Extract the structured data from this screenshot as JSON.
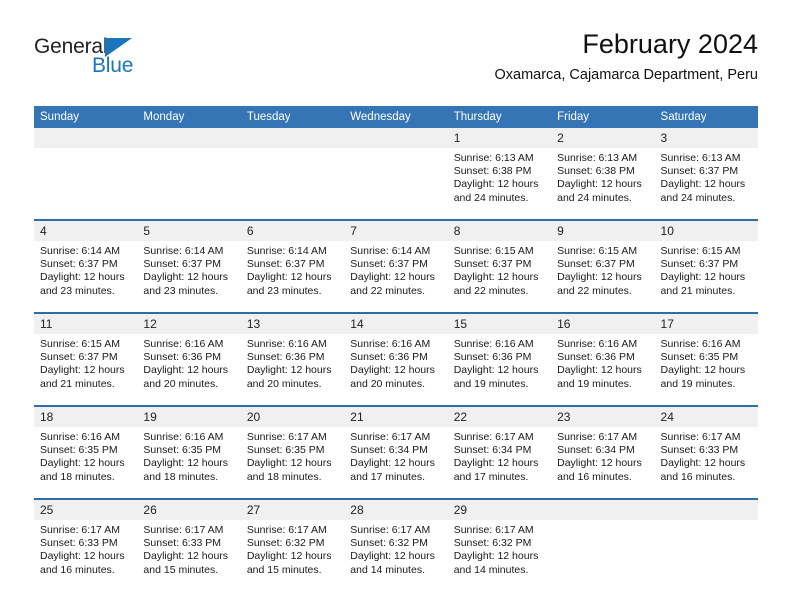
{
  "brand": {
    "name_part1": "General",
    "name_part2": "Blue",
    "accent_color": "#1b75bb",
    "triangle_icon": "logo-triangle-icon"
  },
  "header": {
    "title": "February 2024",
    "subtitle": "Oxamarca, Cajamarca Department, Peru"
  },
  "calendar": {
    "header_bg": "#3575b5",
    "header_text_color": "#ffffff",
    "daynum_bg": "#f0f0f0",
    "week_divider_color": "#2f6da8",
    "weekdays": [
      "Sunday",
      "Monday",
      "Tuesday",
      "Wednesday",
      "Thursday",
      "Friday",
      "Saturday"
    ],
    "weeks": [
      [
        {
          "day": "",
          "sunrise": "",
          "sunset": "",
          "daylight": ""
        },
        {
          "day": "",
          "sunrise": "",
          "sunset": "",
          "daylight": ""
        },
        {
          "day": "",
          "sunrise": "",
          "sunset": "",
          "daylight": ""
        },
        {
          "day": "",
          "sunrise": "",
          "sunset": "",
          "daylight": ""
        },
        {
          "day": "1",
          "sunrise": "Sunrise: 6:13 AM",
          "sunset": "Sunset: 6:38 PM",
          "daylight": "Daylight: 12 hours and 24 minutes."
        },
        {
          "day": "2",
          "sunrise": "Sunrise: 6:13 AM",
          "sunset": "Sunset: 6:38 PM",
          "daylight": "Daylight: 12 hours and 24 minutes."
        },
        {
          "day": "3",
          "sunrise": "Sunrise: 6:13 AM",
          "sunset": "Sunset: 6:37 PM",
          "daylight": "Daylight: 12 hours and 24 minutes."
        }
      ],
      [
        {
          "day": "4",
          "sunrise": "Sunrise: 6:14 AM",
          "sunset": "Sunset: 6:37 PM",
          "daylight": "Daylight: 12 hours and 23 minutes."
        },
        {
          "day": "5",
          "sunrise": "Sunrise: 6:14 AM",
          "sunset": "Sunset: 6:37 PM",
          "daylight": "Daylight: 12 hours and 23 minutes."
        },
        {
          "day": "6",
          "sunrise": "Sunrise: 6:14 AM",
          "sunset": "Sunset: 6:37 PM",
          "daylight": "Daylight: 12 hours and 23 minutes."
        },
        {
          "day": "7",
          "sunrise": "Sunrise: 6:14 AM",
          "sunset": "Sunset: 6:37 PM",
          "daylight": "Daylight: 12 hours and 22 minutes."
        },
        {
          "day": "8",
          "sunrise": "Sunrise: 6:15 AM",
          "sunset": "Sunset: 6:37 PM",
          "daylight": "Daylight: 12 hours and 22 minutes."
        },
        {
          "day": "9",
          "sunrise": "Sunrise: 6:15 AM",
          "sunset": "Sunset: 6:37 PM",
          "daylight": "Daylight: 12 hours and 22 minutes."
        },
        {
          "day": "10",
          "sunrise": "Sunrise: 6:15 AM",
          "sunset": "Sunset: 6:37 PM",
          "daylight": "Daylight: 12 hours and 21 minutes."
        }
      ],
      [
        {
          "day": "11",
          "sunrise": "Sunrise: 6:15 AM",
          "sunset": "Sunset: 6:37 PM",
          "daylight": "Daylight: 12 hours and 21 minutes."
        },
        {
          "day": "12",
          "sunrise": "Sunrise: 6:16 AM",
          "sunset": "Sunset: 6:36 PM",
          "daylight": "Daylight: 12 hours and 20 minutes."
        },
        {
          "day": "13",
          "sunrise": "Sunrise: 6:16 AM",
          "sunset": "Sunset: 6:36 PM",
          "daylight": "Daylight: 12 hours and 20 minutes."
        },
        {
          "day": "14",
          "sunrise": "Sunrise: 6:16 AM",
          "sunset": "Sunset: 6:36 PM",
          "daylight": "Daylight: 12 hours and 20 minutes."
        },
        {
          "day": "15",
          "sunrise": "Sunrise: 6:16 AM",
          "sunset": "Sunset: 6:36 PM",
          "daylight": "Daylight: 12 hours and 19 minutes."
        },
        {
          "day": "16",
          "sunrise": "Sunrise: 6:16 AM",
          "sunset": "Sunset: 6:36 PM",
          "daylight": "Daylight: 12 hours and 19 minutes."
        },
        {
          "day": "17",
          "sunrise": "Sunrise: 6:16 AM",
          "sunset": "Sunset: 6:35 PM",
          "daylight": "Daylight: 12 hours and 19 minutes."
        }
      ],
      [
        {
          "day": "18",
          "sunrise": "Sunrise: 6:16 AM",
          "sunset": "Sunset: 6:35 PM",
          "daylight": "Daylight: 12 hours and 18 minutes."
        },
        {
          "day": "19",
          "sunrise": "Sunrise: 6:16 AM",
          "sunset": "Sunset: 6:35 PM",
          "daylight": "Daylight: 12 hours and 18 minutes."
        },
        {
          "day": "20",
          "sunrise": "Sunrise: 6:17 AM",
          "sunset": "Sunset: 6:35 PM",
          "daylight": "Daylight: 12 hours and 18 minutes."
        },
        {
          "day": "21",
          "sunrise": "Sunrise: 6:17 AM",
          "sunset": "Sunset: 6:34 PM",
          "daylight": "Daylight: 12 hours and 17 minutes."
        },
        {
          "day": "22",
          "sunrise": "Sunrise: 6:17 AM",
          "sunset": "Sunset: 6:34 PM",
          "daylight": "Daylight: 12 hours and 17 minutes."
        },
        {
          "day": "23",
          "sunrise": "Sunrise: 6:17 AM",
          "sunset": "Sunset: 6:34 PM",
          "daylight": "Daylight: 12 hours and 16 minutes."
        },
        {
          "day": "24",
          "sunrise": "Sunrise: 6:17 AM",
          "sunset": "Sunset: 6:33 PM",
          "daylight": "Daylight: 12 hours and 16 minutes."
        }
      ],
      [
        {
          "day": "25",
          "sunrise": "Sunrise: 6:17 AM",
          "sunset": "Sunset: 6:33 PM",
          "daylight": "Daylight: 12 hours and 16 minutes."
        },
        {
          "day": "26",
          "sunrise": "Sunrise: 6:17 AM",
          "sunset": "Sunset: 6:33 PM",
          "daylight": "Daylight: 12 hours and 15 minutes."
        },
        {
          "day": "27",
          "sunrise": "Sunrise: 6:17 AM",
          "sunset": "Sunset: 6:32 PM",
          "daylight": "Daylight: 12 hours and 15 minutes."
        },
        {
          "day": "28",
          "sunrise": "Sunrise: 6:17 AM",
          "sunset": "Sunset: 6:32 PM",
          "daylight": "Daylight: 12 hours and 14 minutes."
        },
        {
          "day": "29",
          "sunrise": "Sunrise: 6:17 AM",
          "sunset": "Sunset: 6:32 PM",
          "daylight": "Daylight: 12 hours and 14 minutes."
        },
        {
          "day": "",
          "sunrise": "",
          "sunset": "",
          "daylight": ""
        },
        {
          "day": "",
          "sunrise": "",
          "sunset": "",
          "daylight": ""
        }
      ]
    ]
  }
}
